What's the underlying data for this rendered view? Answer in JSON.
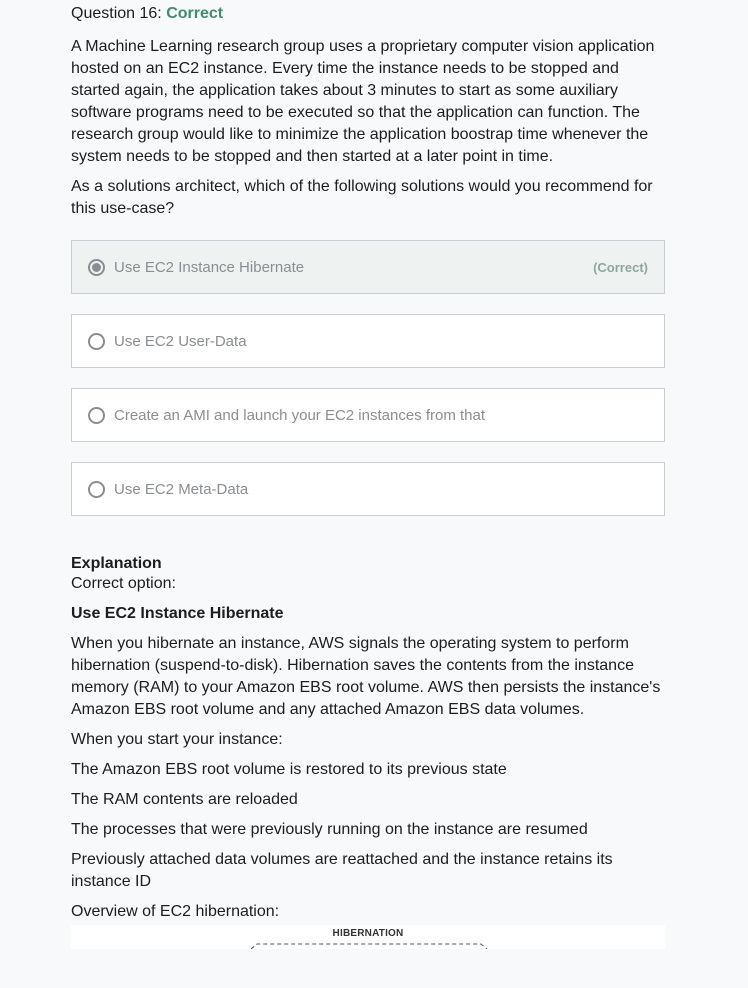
{
  "question": {
    "label": "Question 16:",
    "status": "Correct",
    "text": "A Machine Learning research group uses a proprietary computer vision application hosted on an EC2 instance. Every time the instance needs to be stopped and started again, the application takes about 3 minutes to start as some auxiliary software programs need to be executed so that the application can function. The research group would like to minimize the application boostrap time whenever the system needs to be stopped and then started at a later point in time.",
    "prompt": "As a solutions architect, which of the following solutions would you recommend for this use-case?"
  },
  "options": [
    {
      "label": "Use EC2 Instance Hibernate",
      "tag": "(Correct)",
      "selected": true
    },
    {
      "label": "Use EC2 User-Data",
      "tag": "",
      "selected": false
    },
    {
      "label": "Create an AMI and launch your EC2 instances from that",
      "tag": "",
      "selected": false
    },
    {
      "label": "Use EC2 Meta-Data",
      "tag": "",
      "selected": false
    }
  ],
  "explanation": {
    "heading": "Explanation",
    "subheading": "Correct option:",
    "title": "Use EC2 Instance Hibernate",
    "paragraphs": [
      "When you hibernate an instance, AWS signals the operating system to perform hibernation (suspend-to-disk). Hibernation saves the contents from the instance memory (RAM) to your Amazon EBS root volume. AWS then persists the instance's Amazon EBS root volume and any attached Amazon EBS data volumes.",
      "When you start your instance:",
      "The Amazon EBS root volume is restored to its previous state",
      "The RAM contents are reloaded",
      "The processes that were previously running on the instance are resumed",
      "Previously attached data volumes are reattached and the instance retains its instance ID",
      "Overview of EC2 hibernation:"
    ],
    "diagram_label": "HIBERNATION"
  }
}
